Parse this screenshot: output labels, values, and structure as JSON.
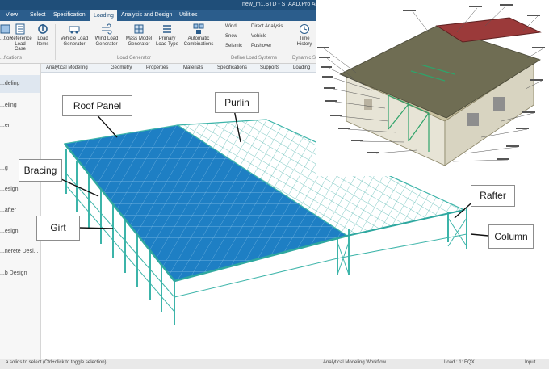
{
  "window": {
    "title": "new_m1.STD - STAAD.Pro Advan"
  },
  "menu": {
    "tabs": [
      {
        "label": "View"
      },
      {
        "label": "Select"
      },
      {
        "label": "Specification"
      },
      {
        "label": "Loading"
      },
      {
        "label": "Analysis and Design"
      },
      {
        "label": "Utilities"
      }
    ]
  },
  "ribbon": {
    "buttons": [
      {
        "label": "...tion"
      },
      {
        "label": "Reference Load Case"
      },
      {
        "label": "Load Items"
      },
      {
        "label": "Vehicle Load Generator"
      },
      {
        "label": "Wind Load Generator"
      },
      {
        "label": "Mass Model Generator"
      },
      {
        "label": "Primary Load Type"
      },
      {
        "label": "Automatic Combinations"
      },
      {
        "label": "Time History"
      }
    ],
    "small_items": {
      "wind": "Wind",
      "snow": "Snow",
      "seismic": "Seismic",
      "direct_analysis": "Direct Analysis",
      "vehicle": "Vehicle",
      "pushover": "Pushover"
    },
    "groups": {
      "specifications": "...fications",
      "load_generator": "Load Generator",
      "define_load_systems": "Define Load Systems",
      "dynamic": "Dynamic S..."
    }
  },
  "left_panel": {
    "items": [
      "...deling",
      "...eling",
      "...er",
      "...g",
      "...esign",
      "...after",
      "...esign",
      "...nerete Desi...",
      "...b Design"
    ]
  },
  "sub_tabs": [
    "Analytical Modeling",
    "Geometry",
    "Properties",
    "Materials",
    "Specifications",
    "Supports",
    "Loading"
  ],
  "callouts": {
    "roof_panel": "Roof Panel",
    "purlin": "Purlin",
    "bracing": "Bracing",
    "girt": "Girt",
    "rafter": "Rafter",
    "column": "Column"
  },
  "status": {
    "left": "...a solids to select (Ctrl+click to toggle selection)",
    "workflow": "Analytical Modeling Workflow",
    "load": "Load : 1: EQX",
    "input": "Input"
  },
  "colors": {
    "title_bar": "#1f4e79",
    "menu_bar": "#2b5d8c",
    "roof_panel": "#1e7fc4",
    "steel_frame": "#3cb4a9"
  }
}
